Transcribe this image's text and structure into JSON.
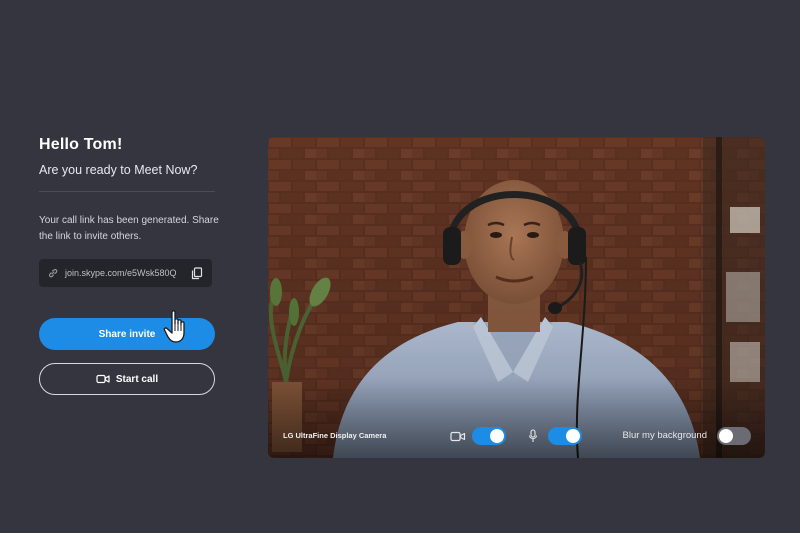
{
  "meeting": {
    "greeting": "Hello  Tom!",
    "subtitle": "Are you ready to Meet Now?",
    "info_text": "Your call link has been generated. Share the link to invite others.",
    "call_link": "join.skype.com/e5Wsk580Q",
    "share_label": "Share invite",
    "start_label": "Start call"
  },
  "video": {
    "camera_name": "LG UltraFine Display Camera",
    "video_toggle_on": true,
    "mic_toggle_on": true,
    "blur_label": "Blur my background",
    "blur_toggle_on": false
  },
  "colors": {
    "background": "#35353f",
    "accent": "#1c8ce6",
    "link_box": "#24242b"
  },
  "icons": [
    "link-icon",
    "copy-icon",
    "video-camera-icon",
    "hand-cursor-icon",
    "camera-icon",
    "microphone-icon"
  ]
}
